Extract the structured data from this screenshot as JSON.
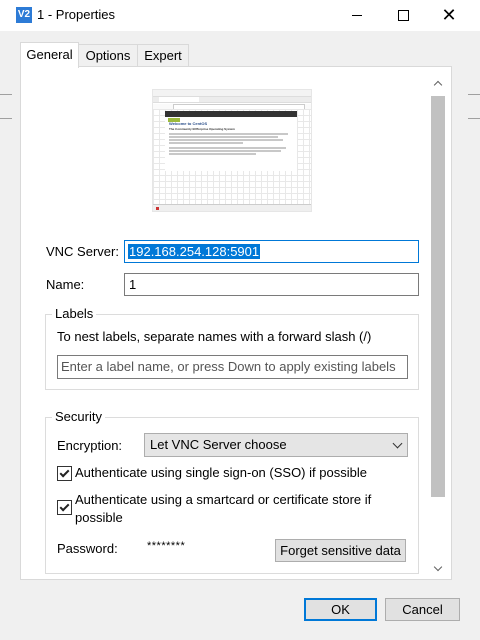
{
  "window": {
    "icon_text": "V2",
    "title": "1 - Properties"
  },
  "tabs": [
    {
      "label": "General",
      "active": true
    },
    {
      "label": "Options",
      "active": false
    },
    {
      "label": "Expert",
      "active": false
    }
  ],
  "preview": {
    "page_heading": "Welcome to CentOS",
    "page_subheading": "The Community ENTerprise Operating System"
  },
  "general": {
    "vnc_server_label": "VNC Server:",
    "vnc_server_value": "192.168.254.128:5901",
    "name_label": "Name:",
    "name_value": "1"
  },
  "labels_group": {
    "title": "Labels",
    "hint": "To nest labels, separate names with a forward slash (/)",
    "placeholder": "Enter a label name, or press Down to apply existing labels"
  },
  "security": {
    "title": "Security",
    "encryption_label": "Encryption:",
    "encryption_value": "Let VNC Server choose",
    "sso_label": "Authenticate using single sign-on (SSO) if possible",
    "sso_checked": true,
    "smartcard_label": "Authenticate using a smartcard or certificate store if possible",
    "smartcard_checked": true,
    "password_label": "Password:",
    "password_value": "********",
    "forget_button": "Forget sensitive data"
  },
  "buttons": {
    "ok": "OK",
    "cancel": "Cancel"
  },
  "colors": {
    "accent": "#0078d7",
    "dialog_background": "#f0f0f0",
    "panel_background": "#ffffff"
  }
}
